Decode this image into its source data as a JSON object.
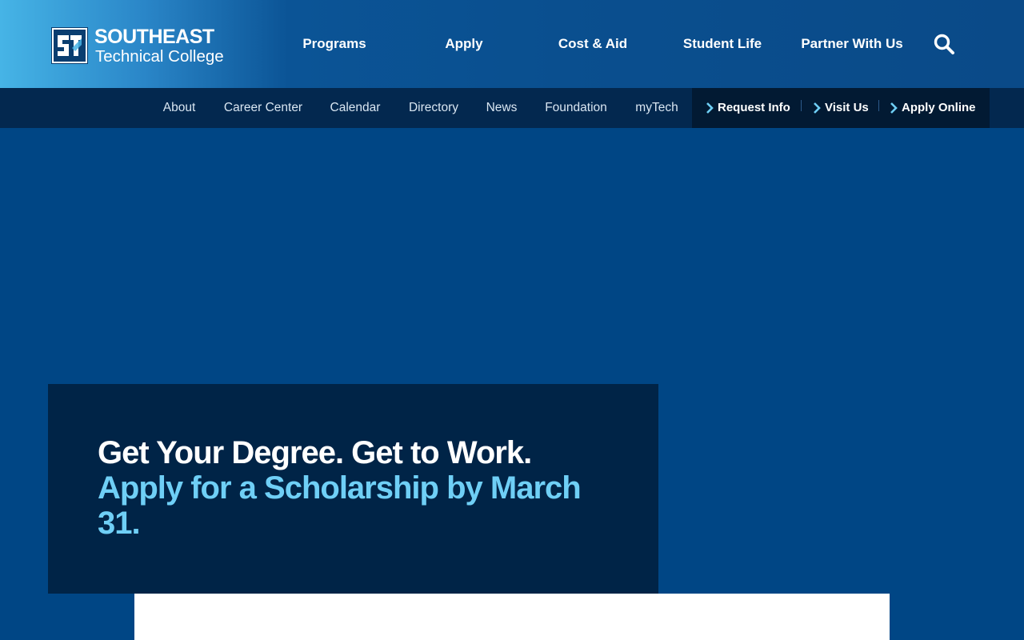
{
  "brand": {
    "name_line1": "SOUTHEAST",
    "name_line2": "Technical College",
    "colors": {
      "primary": "#004685",
      "header_gradient_start": "#46b4e6",
      "utility_bar": "#03284f",
      "hero_card": "#002447",
      "accent": "#6fcff6"
    }
  },
  "main_nav": {
    "items": [
      {
        "label": "Programs"
      },
      {
        "label": "Apply"
      },
      {
        "label": "Cost & Aid"
      },
      {
        "label": "Student Life"
      },
      {
        "label": "Partner With Us"
      }
    ],
    "search_icon": "search-icon"
  },
  "utility_nav": {
    "items": [
      {
        "label": "About"
      },
      {
        "label": "Career Center"
      },
      {
        "label": "Calendar"
      },
      {
        "label": "Directory"
      },
      {
        "label": "News"
      },
      {
        "label": "Foundation"
      },
      {
        "label": "myTech"
      }
    ],
    "cta": [
      {
        "label": "Request Info",
        "icon": "chevron-right-icon"
      },
      {
        "label": "Visit Us",
        "icon": "chevron-right-icon"
      },
      {
        "label": "Apply Online",
        "icon": "chevron-right-icon"
      }
    ]
  },
  "hero": {
    "headline": "Get Your Degree. Get to Work.",
    "subheadline": "Apply for a Scholarship by March 31."
  }
}
